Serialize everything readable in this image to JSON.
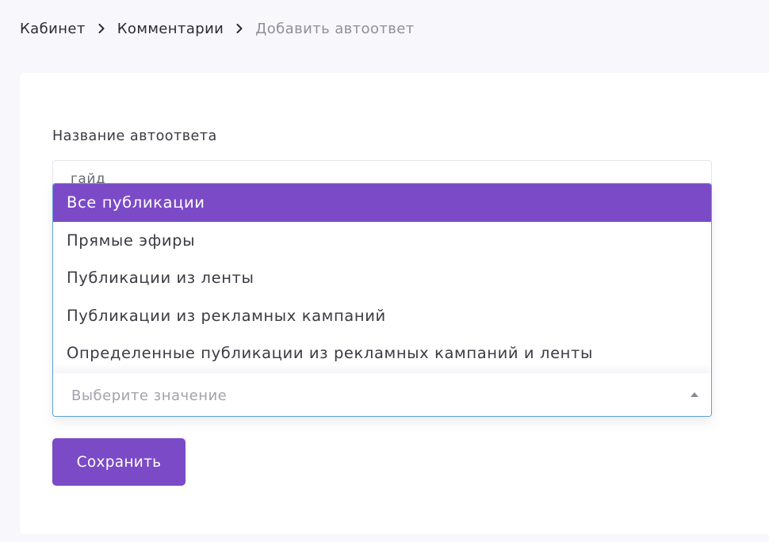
{
  "breadcrumb": {
    "items": [
      "Кабинет",
      "Комментарии"
    ],
    "current": "Добавить автоответ",
    "separator_icon": "chevron-right-icon"
  },
  "form": {
    "name_label": "Название автоответа",
    "name_value": "гайд",
    "select": {
      "placeholder": "Выберите значение",
      "caret_icon": "caret-up-icon",
      "options": [
        {
          "label": "Все публикации",
          "highlighted": true
        },
        {
          "label": "Прямые эфиры",
          "highlighted": false
        },
        {
          "label": "Публикации из ленты",
          "highlighted": false
        },
        {
          "label": "Публикации из рекламных кампаний",
          "highlighted": false
        },
        {
          "label": "Определенные публикации из рекламных кампаний и ленты",
          "highlighted": false
        }
      ]
    },
    "save_label": "Сохранить"
  },
  "colors": {
    "accent": "#7b4ac7",
    "background": "#f8f8fc",
    "card": "#ffffff",
    "focus_border": "#5e9fd8",
    "placeholder": "#a2a2ae"
  }
}
